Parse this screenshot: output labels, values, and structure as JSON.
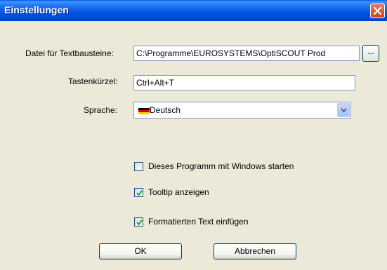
{
  "window": {
    "title": "Einstellungen"
  },
  "form": {
    "file_label": "Datei für Textbausteine:",
    "file_value": "C:\\Programme\\EUROSYSTEMS\\OptiSCOUT Prod",
    "browse_label": "...",
    "hotkey_label": "Tastenkürzel:",
    "hotkey_value": "Ctrl+Alt+T",
    "language_label": "Sprache:",
    "language_value": "Deutsch"
  },
  "options": [
    {
      "label": "Dieses Programm mit Windows starten",
      "checked": false
    },
    {
      "label": "Tooltip anzeigen",
      "checked": true
    },
    {
      "label": "Formatierten Text einfügen",
      "checked": true
    }
  ],
  "buttons": {
    "ok": "OK",
    "cancel": "Abbrechen"
  },
  "colors": {
    "titlebar": "#0055E5",
    "dialog_bg": "#ECE9D8",
    "close": "#D9532E",
    "check": "#21A121"
  }
}
